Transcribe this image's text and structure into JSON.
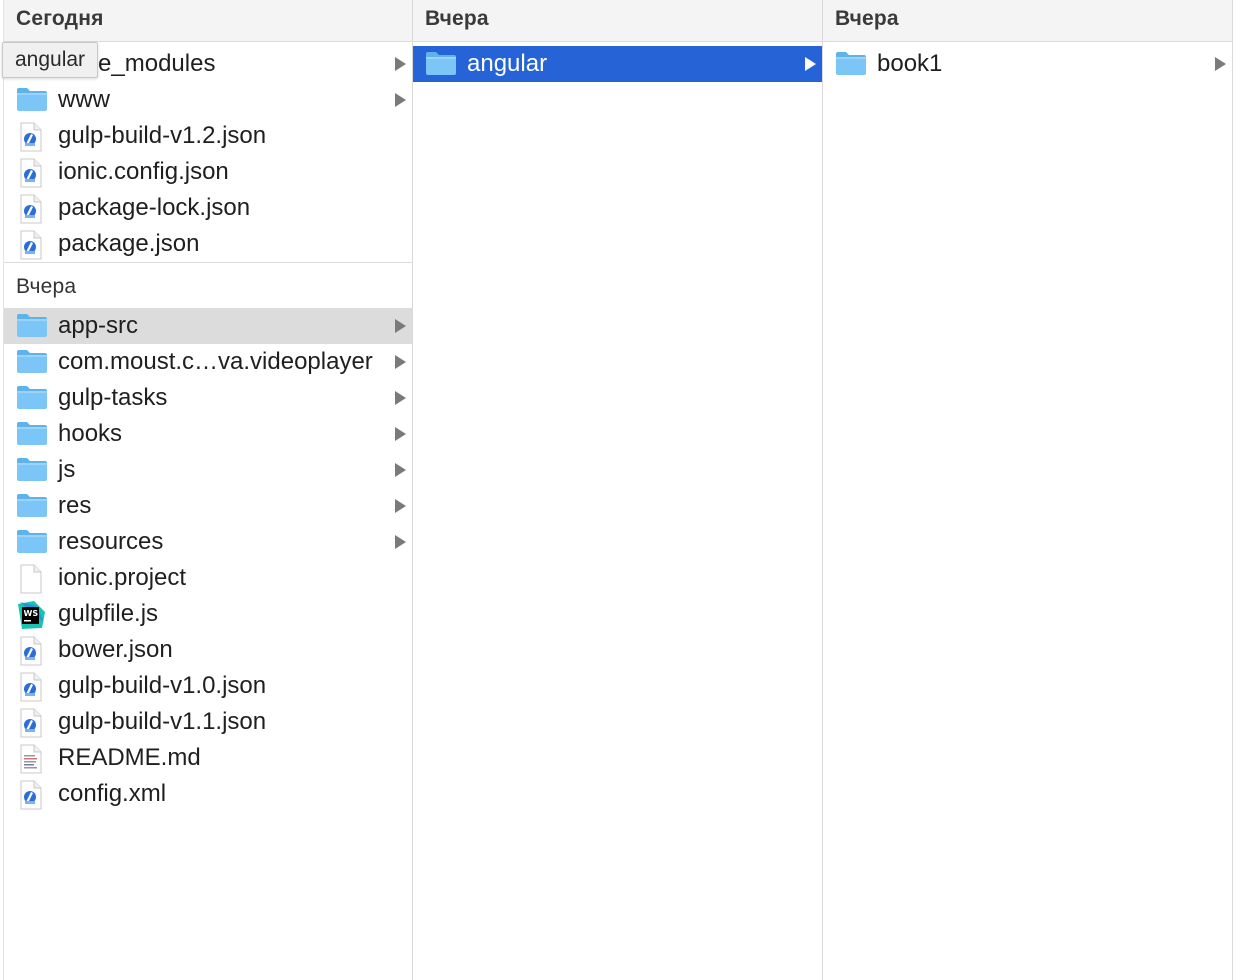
{
  "columns": [
    {
      "sections": [
        {
          "header": "Сегодня",
          "items": [
            {
              "name": "node_modules",
              "kind": "folder",
              "has_children": true
            },
            {
              "name": "www",
              "kind": "folder",
              "has_children": true
            },
            {
              "name": "gulp-build-v1.2.json",
              "kind": "json",
              "has_children": false
            },
            {
              "name": "ionic.config.json",
              "kind": "json",
              "has_children": false
            },
            {
              "name": "package-lock.json",
              "kind": "json",
              "has_children": false
            },
            {
              "name": "package.json",
              "kind": "json",
              "has_children": false
            }
          ]
        },
        {
          "header": "Вчера",
          "items": [
            {
              "name": "app-src",
              "kind": "folder",
              "has_children": true,
              "state": "hover"
            },
            {
              "name": "com.moust.c…va.videoplayer",
              "kind": "folder",
              "has_children": true
            },
            {
              "name": "gulp-tasks",
              "kind": "folder",
              "has_children": true
            },
            {
              "name": "hooks",
              "kind": "folder",
              "has_children": true
            },
            {
              "name": "js",
              "kind": "folder",
              "has_children": true
            },
            {
              "name": "res",
              "kind": "folder",
              "has_children": true
            },
            {
              "name": "resources",
              "kind": "folder",
              "has_children": true
            },
            {
              "name": "ionic.project",
              "kind": "blank",
              "has_children": false
            },
            {
              "name": "gulpfile.js",
              "kind": "webstorm",
              "has_children": false
            },
            {
              "name": "bower.json",
              "kind": "json",
              "has_children": false
            },
            {
              "name": "gulp-build-v1.0.json",
              "kind": "json",
              "has_children": false
            },
            {
              "name": "gulp-build-v1.1.json",
              "kind": "json",
              "has_children": false
            },
            {
              "name": "README.md",
              "kind": "text",
              "has_children": false
            },
            {
              "name": "config.xml",
              "kind": "json",
              "has_children": false
            }
          ]
        }
      ]
    },
    {
      "sections": [
        {
          "header": "Вчера",
          "items": [
            {
              "name": "angular",
              "kind": "folder",
              "has_children": true,
              "state": "selected"
            }
          ]
        }
      ]
    },
    {
      "sections": [
        {
          "header": "Вчера",
          "items": [
            {
              "name": "book1",
              "kind": "folder",
              "has_children": true
            }
          ]
        }
      ]
    }
  ],
  "tooltip": {
    "text": "angular"
  },
  "colors": {
    "selection": "#2563d6",
    "hover": "#dcdcdc",
    "folder": "#7cc4f5"
  }
}
